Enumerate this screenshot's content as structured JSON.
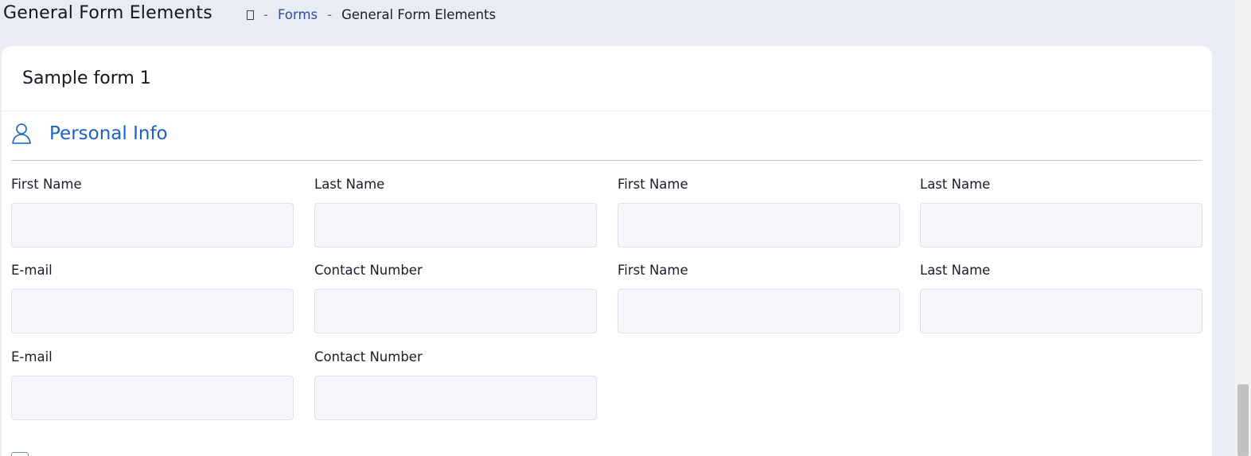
{
  "header": {
    "title": "General Form Elements",
    "breadcrumb": {
      "home_icon": "home-icon",
      "separator": "-",
      "items": [
        "Forms",
        "General Form Elements"
      ]
    }
  },
  "card": {
    "title": "Sample form 1",
    "section": {
      "icon": "person-icon",
      "title": "Personal Info",
      "accent_color": "#1b5fc9"
    },
    "fields": [
      {
        "label": "First Name",
        "value": "",
        "placeholder": ""
      },
      {
        "label": "Last Name",
        "value": "",
        "placeholder": ""
      },
      {
        "label": "First Name",
        "value": "",
        "placeholder": ""
      },
      {
        "label": "Last Name",
        "value": "",
        "placeholder": ""
      },
      {
        "label": "E-mail",
        "value": "",
        "placeholder": ""
      },
      {
        "label": "Contact Number",
        "value": "",
        "placeholder": ""
      },
      {
        "label": "First Name",
        "value": "",
        "placeholder": ""
      },
      {
        "label": "Last Name",
        "value": "",
        "placeholder": ""
      },
      {
        "label": "E-mail",
        "value": "",
        "placeholder": ""
      },
      {
        "label": "Contact Number",
        "value": "",
        "placeholder": ""
      }
    ]
  }
}
